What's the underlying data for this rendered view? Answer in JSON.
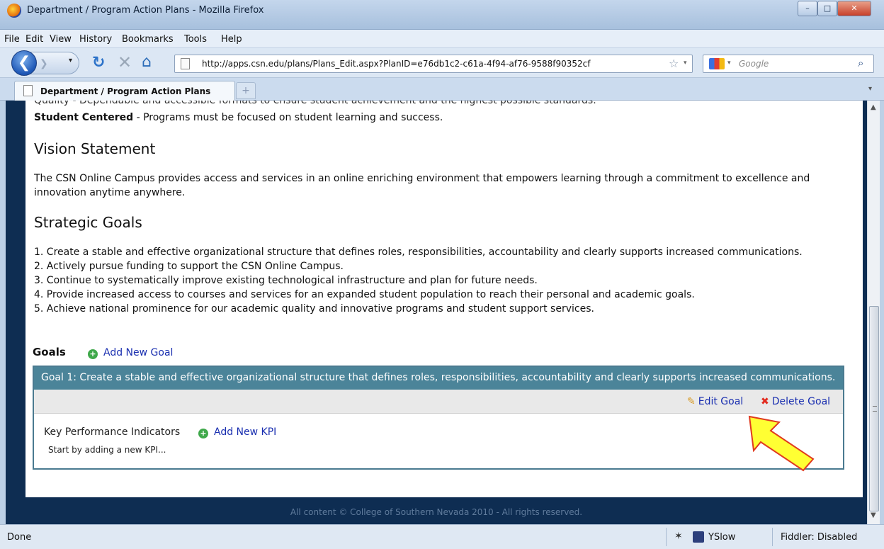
{
  "window": {
    "title": "Department / Program Action Plans - Mozilla Firefox"
  },
  "menu": [
    "File",
    "Edit",
    "View",
    "History",
    "Bookmarks",
    "Tools",
    "Help"
  ],
  "nav": {
    "url": "http://apps.csn.edu/plans/Plans_Edit.aspx?PlanID=e76db1c2-c61a-4f94-af76-9588f90352cf",
    "search_placeholder": "Google"
  },
  "tabs": [
    {
      "label": "Department / Program Action Plans"
    }
  ],
  "content": {
    "values_partial_line": "Quality - Dependable and accessible formats to ensure student achievement and the highest possible standards.",
    "student_centered_label": "Student Centered",
    "student_centered_text": " - Programs must be focused on student learning and success.",
    "vision_title": "Vision Statement",
    "vision_text_1": "The CSN Online Campus provides access and services in an online enriching environment that empowers learning through a commitment to excellence and",
    "vision_text_2": "innovation anytime anywhere.",
    "strategic_title": "Strategic Goals",
    "strategic_goals": [
      "1.  Create a stable and effective organizational structure that defines roles, responsibilities, accountability and clearly supports increased communications.",
      "2.  Actively pursue funding to support the CSN Online Campus.",
      "3.  Continue to systematically improve existing technological infrastructure and plan for future needs.",
      "4.  Provide increased access to courses and services for an expanded student population to reach their personal and academic goals.",
      "5.  Achieve national prominence for our academic quality and innovative programs and student support services."
    ],
    "goals_label": "Goals",
    "add_goal": "Add New Goal",
    "goal1_header": "Goal 1: Create a stable and effective organizational structure that defines roles, responsibilities, accountability and clearly supports increased communications.",
    "edit_goal": "Edit Goal",
    "delete_goal": "Delete Goal",
    "kpi_label": "Key Performance Indicators",
    "add_kpi": "Add New KPI",
    "kpi_empty": "Start by adding a new KPI...",
    "footer": "All content © College of Southern Nevada 2010 - All rights reserved."
  },
  "status": {
    "text": "Done",
    "yslow": "YSlow",
    "fiddler": "Fiddler: Disabled"
  },
  "colors": {
    "goal_header": "#4b8499",
    "page_bg": "#0e2d52",
    "link": "#1a2fb0",
    "arrow_fill": "#ffff33",
    "arrow_stroke": "#e03a1e"
  }
}
